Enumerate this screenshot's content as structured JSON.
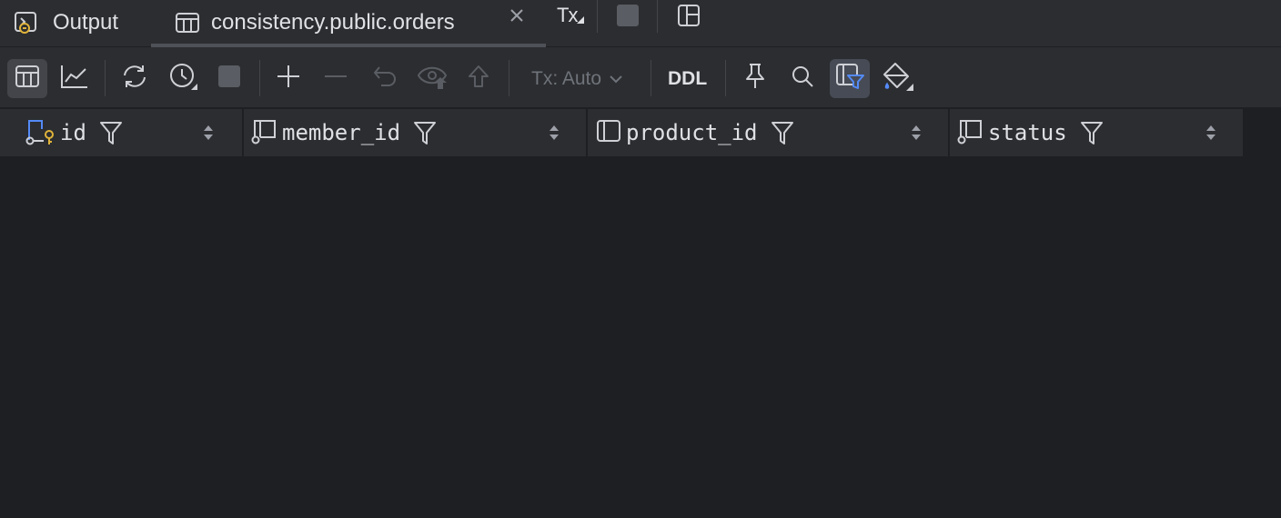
{
  "tabs": [
    {
      "label": "Output"
    },
    {
      "label": "consistency.public.orders"
    },
    {
      "label": "Tx"
    }
  ],
  "toolbar": {
    "tx_mode": "Tx: Auto",
    "ddl_label": "DDL"
  },
  "columns": [
    {
      "name": "id"
    },
    {
      "name": "member_id"
    },
    {
      "name": "product_id"
    },
    {
      "name": "status"
    }
  ],
  "colors": {
    "background": "#1e1f22",
    "panel": "#2b2d30",
    "text": "#dfe1e5",
    "muted": "#6f737a",
    "accent_blue": "#548af7",
    "key_gold": "#e0b33a"
  }
}
